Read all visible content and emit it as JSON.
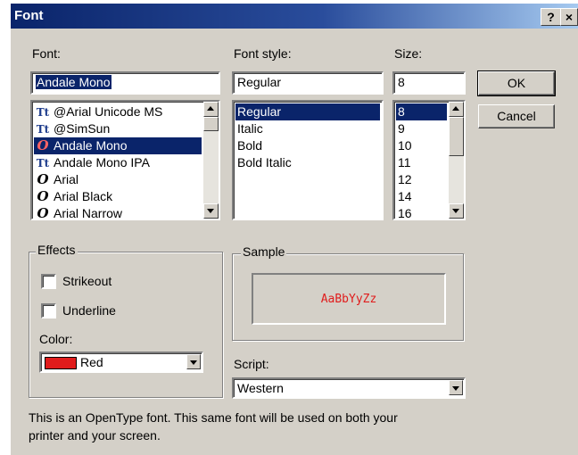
{
  "window": {
    "title": "Font",
    "help_label": "?",
    "close_label": "×"
  },
  "font": {
    "label": "Font:",
    "value": "Andale Mono",
    "items": [
      {
        "icon": "truetype-icon",
        "glyph": "Tt",
        "label": "@Arial Unicode MS"
      },
      {
        "icon": "truetype-icon",
        "glyph": "Tt",
        "label": "@SimSun"
      },
      {
        "icon": "opentype-icon",
        "glyph": "O",
        "label": "Andale Mono"
      },
      {
        "icon": "truetype-icon",
        "glyph": "Tt",
        "label": "Andale Mono IPA"
      },
      {
        "icon": "opentype-icon",
        "glyph": "O",
        "label": "Arial"
      },
      {
        "icon": "opentype-icon",
        "glyph": "O",
        "label": "Arial Black"
      },
      {
        "icon": "opentype-icon",
        "glyph": "O",
        "label": "Arial Narrow"
      }
    ],
    "selected_index": 2
  },
  "style": {
    "label": "Font style:",
    "value": "Regular",
    "items": [
      "Regular",
      "Italic",
      "Bold",
      "Bold Italic"
    ],
    "selected_index": 0
  },
  "size": {
    "label": "Size:",
    "value": "8",
    "items": [
      "8",
      "9",
      "10",
      "11",
      "12",
      "14",
      "16"
    ],
    "selected_index": 0
  },
  "buttons": {
    "ok": "OK",
    "cancel": "Cancel"
  },
  "effects": {
    "label": "Effects",
    "strikeout": "Strikeout",
    "strikeout_checked": false,
    "underline": "Underline",
    "underline_checked": false,
    "color_label": "Color:",
    "color_value": "Red",
    "color_swatch": "#e01c1c"
  },
  "sample": {
    "label": "Sample",
    "text": "AaBbYyZz",
    "color": "#e01c1c"
  },
  "script": {
    "label": "Script:",
    "value": "Western"
  },
  "footer": {
    "line1": "This is an OpenType font. This same font will be used on both your",
    "line2": "printer and your screen."
  },
  "colors": {
    "titlebar": "#0a246a",
    "face": "#d4d0c8",
    "selection": "#0a246a"
  }
}
